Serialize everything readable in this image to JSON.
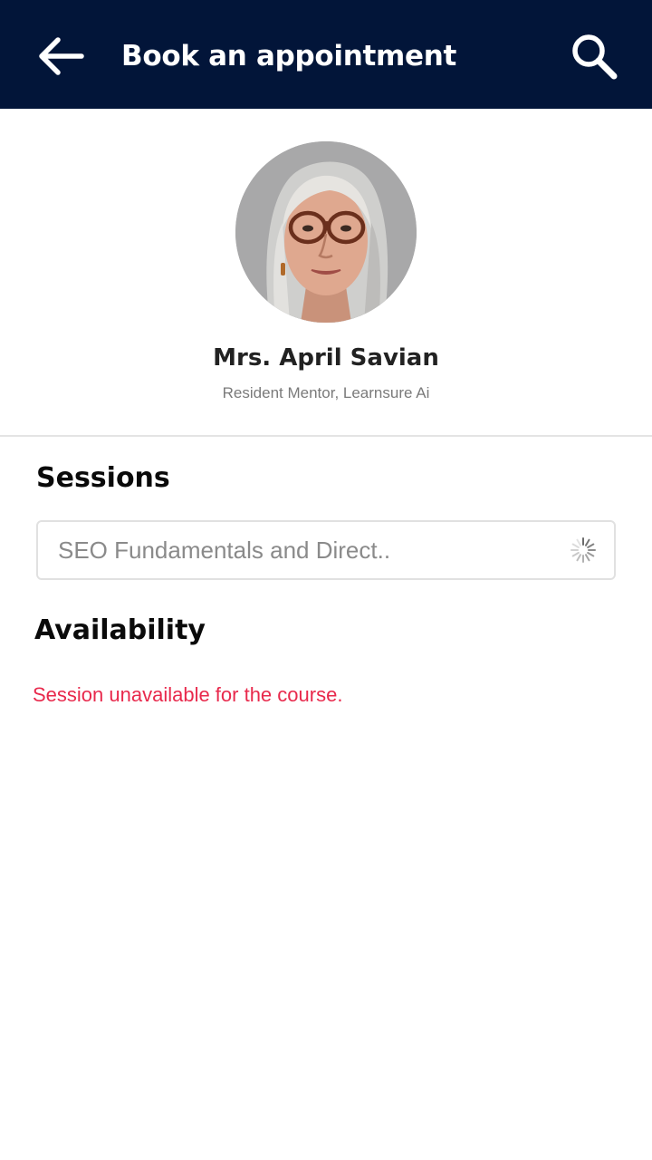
{
  "header": {
    "title": "Book an appointment",
    "back_icon": "arrow-left-icon",
    "search_icon": "search-icon",
    "background": "#021539"
  },
  "mentor": {
    "name": "Mrs. April Savian",
    "role": "Resident Mentor, Learnsure Ai"
  },
  "sessions": {
    "title": "Sessions",
    "selected": "SEO Fundamentals and Direct..",
    "status_icon": "loading-spinner-icon"
  },
  "availability": {
    "title": "Availability",
    "message": "Session unavailable for the course.",
    "message_color": "#e8294c"
  }
}
